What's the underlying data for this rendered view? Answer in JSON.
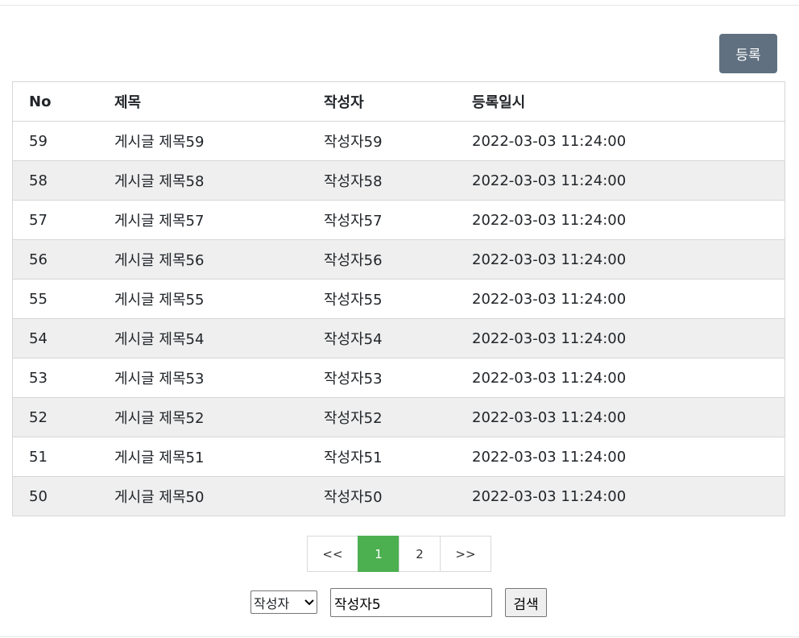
{
  "header": {
    "register_label": "등록"
  },
  "table": {
    "columns": [
      "No",
      "제목",
      "작성자",
      "등록일시"
    ],
    "rows": [
      [
        "59",
        "게시글 제목59",
        "작성자59",
        "2022-03-03 11:24:00"
      ],
      [
        "58",
        "게시글 제목58",
        "작성자58",
        "2022-03-03 11:24:00"
      ],
      [
        "57",
        "게시글 제목57",
        "작성자57",
        "2022-03-03 11:24:00"
      ],
      [
        "56",
        "게시글 제목56",
        "작성자56",
        "2022-03-03 11:24:00"
      ],
      [
        "55",
        "게시글 제목55",
        "작성자55",
        "2022-03-03 11:24:00"
      ],
      [
        "54",
        "게시글 제목54",
        "작성자54",
        "2022-03-03 11:24:00"
      ],
      [
        "53",
        "게시글 제목53",
        "작성자53",
        "2022-03-03 11:24:00"
      ],
      [
        "52",
        "게시글 제목52",
        "작성자52",
        "2022-03-03 11:24:00"
      ],
      [
        "51",
        "게시글 제목51",
        "작성자51",
        "2022-03-03 11:24:00"
      ],
      [
        "50",
        "게시글 제목50",
        "작성자50",
        "2022-03-03 11:24:00"
      ]
    ]
  },
  "pagination": {
    "first_label": "<<",
    "pages": [
      "1",
      "2"
    ],
    "active_page": "1",
    "last_label": ">>"
  },
  "search": {
    "field_selected": "작성자",
    "query_value": "작성자5",
    "button_label": "검색"
  },
  "colors": {
    "register_button": "#607080",
    "active_page": "#4caf50",
    "row_stripe": "#efefef"
  }
}
